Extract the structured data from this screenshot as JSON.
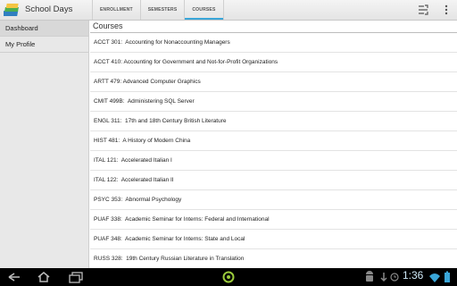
{
  "app": {
    "title": "School Days",
    "icon": "books-icon"
  },
  "tabs": [
    {
      "label": "ENROLLMENT",
      "selected": false
    },
    {
      "label": "SEMESTERS",
      "selected": false
    },
    {
      "label": "COURSES",
      "selected": true
    }
  ],
  "actionbar": {
    "actions": [
      "scale-filter-icon",
      "overflow-menu-icon"
    ]
  },
  "sidebar": {
    "items": [
      {
        "label": "Dashboard",
        "active": true
      },
      {
        "label": "My Profile",
        "active": false
      }
    ]
  },
  "main": {
    "title": "Courses",
    "courses": [
      "ACCT 301:  Accounting for Nonaccounting Managers",
      "ACCT 410: Accounting for Government and Not-for-Profit Organizations",
      "ARTT 479: Advanced Computer Graphics",
      "CMIT 499B:  Administering SQL Server",
      "ENGL 311:  17th and 18th Century British Literature",
      "HIST 481:  A History of Modern China",
      "ITAL 121:  Accelerated Italian I",
      "ITAL 122:  Accelerated Italian II",
      "PSYC 353:  Abnormal Psychology",
      "PUAF 338:  Academic Seminar for Interns: Federal and International",
      "PUAF 348:  Academic Seminar for Interns: State and Local",
      "RUSS 328:  19th Century Russian Literature in Translation"
    ]
  },
  "system_bar": {
    "time": "1:36",
    "colors": {
      "clock": "#cfe9f7",
      "accent": "#3aa6d8",
      "selected_icon": "#9ccc3c"
    }
  }
}
